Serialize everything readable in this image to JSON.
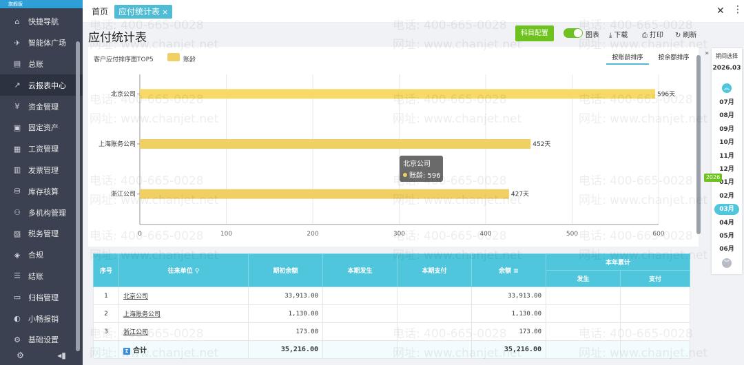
{
  "brand": "旗舰版",
  "sidebar": {
    "items": [
      {
        "label": "快捷导航",
        "icon": "home-icon"
      },
      {
        "label": "智能体广场",
        "icon": "rocket-icon"
      },
      {
        "label": "总账",
        "icon": "ledger-icon"
      },
      {
        "label": "云报表中心",
        "icon": "chart-icon"
      },
      {
        "label": "资金管理",
        "icon": "coin-icon"
      },
      {
        "label": "固定资产",
        "icon": "asset-icon"
      },
      {
        "label": "工资管理",
        "icon": "salary-icon"
      },
      {
        "label": "发票管理",
        "icon": "invoice-icon"
      },
      {
        "label": "库存核算",
        "icon": "inventory-icon"
      },
      {
        "label": "多机构管理",
        "icon": "org-icon"
      },
      {
        "label": "税务管理",
        "icon": "tax-icon"
      },
      {
        "label": "合规",
        "icon": "shield-icon"
      },
      {
        "label": "结账",
        "icon": "checkout-icon"
      },
      {
        "label": "归档管理",
        "icon": "archive-icon"
      },
      {
        "label": "小畅报销",
        "icon": "reimburse-icon"
      },
      {
        "label": "基础设置",
        "icon": "settings-icon"
      }
    ]
  },
  "tabs": {
    "home": "首页",
    "active": "应付统计表"
  },
  "header": {
    "title": "应付统计表",
    "config_button": "科目配置",
    "chart_toggle_label": "图表",
    "download": "下载",
    "print": "打印",
    "refresh": "刷新"
  },
  "chart_card": {
    "caption": "客户应付排序图TOP5",
    "sort_by_age": "按账龄排序",
    "sort_by_balance": "按余额排序"
  },
  "chart_data": {
    "type": "bar",
    "orientation": "horizontal",
    "categories": [
      "北京公司",
      "上海账务公司",
      "浙江公司"
    ],
    "series": [
      {
        "name": "账龄",
        "values": [
          596,
          452,
          427
        ],
        "color": "#f0cf63"
      }
    ],
    "value_suffix": "天",
    "xlim": [
      0,
      600
    ],
    "xticks": [
      0,
      100,
      200,
      300,
      400,
      500,
      600
    ],
    "grid": true,
    "legend": "top-left",
    "tooltip": {
      "title": "北京公司",
      "label": "账龄: 596"
    }
  },
  "table": {
    "headers": {
      "index": "序号",
      "party": "往来单位",
      "opening": "期初余额",
      "occurred": "本期发生",
      "paid": "本期支付",
      "balance": "余额",
      "ytd": "本年累计",
      "ytd_occurred": "发生",
      "ytd_paid": "支付"
    },
    "rows": [
      {
        "index": "1",
        "party": "北京公司",
        "opening": "33,913.00",
        "occurred": "",
        "paid": "",
        "balance": "33,913.00",
        "ytd_occurred": "",
        "ytd_paid": ""
      },
      {
        "index": "2",
        "party": "上海账务公司",
        "opening": "1,130.00",
        "occurred": "",
        "paid": "",
        "balance": "1,130.00",
        "ytd_occurred": "",
        "ytd_paid": ""
      },
      {
        "index": "3",
        "party": "浙江公司",
        "opening": "173.00",
        "occurred": "",
        "paid": "",
        "balance": "173.00",
        "ytd_occurred": "",
        "ytd_paid": ""
      }
    ],
    "total": {
      "label": "合计",
      "opening": "35,216.00",
      "balance": "35,216.00"
    }
  },
  "period": {
    "title": "期间选择",
    "current": "2026.03",
    "months": [
      "07月",
      "08月",
      "09月",
      "10月",
      "11月",
      "12月",
      "01月",
      "02月",
      "03月",
      "04月",
      "05月",
      "06月"
    ],
    "selected": "03月",
    "year_badge": "2026"
  },
  "watermark": {
    "phone": "电话: 400-665-0028",
    "site": "网址: www.chanjet.net"
  },
  "colors": {
    "sidebar_bg": "#3b4150",
    "accent": "#4fc6dc",
    "green": "#6ec21f",
    "bar": "#f0cf63"
  }
}
